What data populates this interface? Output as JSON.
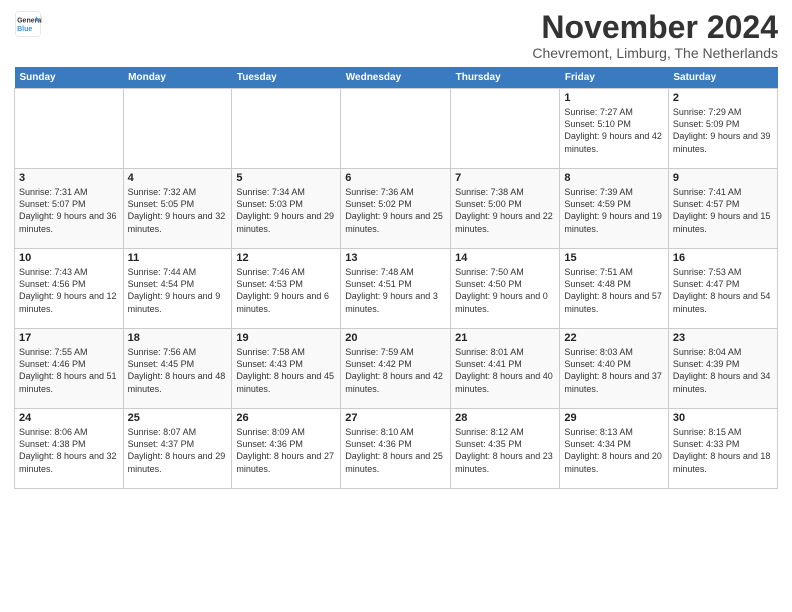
{
  "logo": {
    "general": "General",
    "blue": "Blue"
  },
  "title": "November 2024",
  "location": "Chevremont, Limburg, The Netherlands",
  "days_header": [
    "Sunday",
    "Monday",
    "Tuesday",
    "Wednesday",
    "Thursday",
    "Friday",
    "Saturday"
  ],
  "weeks": [
    [
      {
        "day": "",
        "info": ""
      },
      {
        "day": "",
        "info": ""
      },
      {
        "day": "",
        "info": ""
      },
      {
        "day": "",
        "info": ""
      },
      {
        "day": "",
        "info": ""
      },
      {
        "day": "1",
        "info": "Sunrise: 7:27 AM\nSunset: 5:10 PM\nDaylight: 9 hours and 42 minutes."
      },
      {
        "day": "2",
        "info": "Sunrise: 7:29 AM\nSunset: 5:09 PM\nDaylight: 9 hours and 39 minutes."
      }
    ],
    [
      {
        "day": "3",
        "info": "Sunrise: 7:31 AM\nSunset: 5:07 PM\nDaylight: 9 hours and 36 minutes."
      },
      {
        "day": "4",
        "info": "Sunrise: 7:32 AM\nSunset: 5:05 PM\nDaylight: 9 hours and 32 minutes."
      },
      {
        "day": "5",
        "info": "Sunrise: 7:34 AM\nSunset: 5:03 PM\nDaylight: 9 hours and 29 minutes."
      },
      {
        "day": "6",
        "info": "Sunrise: 7:36 AM\nSunset: 5:02 PM\nDaylight: 9 hours and 25 minutes."
      },
      {
        "day": "7",
        "info": "Sunrise: 7:38 AM\nSunset: 5:00 PM\nDaylight: 9 hours and 22 minutes."
      },
      {
        "day": "8",
        "info": "Sunrise: 7:39 AM\nSunset: 4:59 PM\nDaylight: 9 hours and 19 minutes."
      },
      {
        "day": "9",
        "info": "Sunrise: 7:41 AM\nSunset: 4:57 PM\nDaylight: 9 hours and 15 minutes."
      }
    ],
    [
      {
        "day": "10",
        "info": "Sunrise: 7:43 AM\nSunset: 4:56 PM\nDaylight: 9 hours and 12 minutes."
      },
      {
        "day": "11",
        "info": "Sunrise: 7:44 AM\nSunset: 4:54 PM\nDaylight: 9 hours and 9 minutes."
      },
      {
        "day": "12",
        "info": "Sunrise: 7:46 AM\nSunset: 4:53 PM\nDaylight: 9 hours and 6 minutes."
      },
      {
        "day": "13",
        "info": "Sunrise: 7:48 AM\nSunset: 4:51 PM\nDaylight: 9 hours and 3 minutes."
      },
      {
        "day": "14",
        "info": "Sunrise: 7:50 AM\nSunset: 4:50 PM\nDaylight: 9 hours and 0 minutes."
      },
      {
        "day": "15",
        "info": "Sunrise: 7:51 AM\nSunset: 4:48 PM\nDaylight: 8 hours and 57 minutes."
      },
      {
        "day": "16",
        "info": "Sunrise: 7:53 AM\nSunset: 4:47 PM\nDaylight: 8 hours and 54 minutes."
      }
    ],
    [
      {
        "day": "17",
        "info": "Sunrise: 7:55 AM\nSunset: 4:46 PM\nDaylight: 8 hours and 51 minutes."
      },
      {
        "day": "18",
        "info": "Sunrise: 7:56 AM\nSunset: 4:45 PM\nDaylight: 8 hours and 48 minutes."
      },
      {
        "day": "19",
        "info": "Sunrise: 7:58 AM\nSunset: 4:43 PM\nDaylight: 8 hours and 45 minutes."
      },
      {
        "day": "20",
        "info": "Sunrise: 7:59 AM\nSunset: 4:42 PM\nDaylight: 8 hours and 42 minutes."
      },
      {
        "day": "21",
        "info": "Sunrise: 8:01 AM\nSunset: 4:41 PM\nDaylight: 8 hours and 40 minutes."
      },
      {
        "day": "22",
        "info": "Sunrise: 8:03 AM\nSunset: 4:40 PM\nDaylight: 8 hours and 37 minutes."
      },
      {
        "day": "23",
        "info": "Sunrise: 8:04 AM\nSunset: 4:39 PM\nDaylight: 8 hours and 34 minutes."
      }
    ],
    [
      {
        "day": "24",
        "info": "Sunrise: 8:06 AM\nSunset: 4:38 PM\nDaylight: 8 hours and 32 minutes."
      },
      {
        "day": "25",
        "info": "Sunrise: 8:07 AM\nSunset: 4:37 PM\nDaylight: 8 hours and 29 minutes."
      },
      {
        "day": "26",
        "info": "Sunrise: 8:09 AM\nSunset: 4:36 PM\nDaylight: 8 hours and 27 minutes."
      },
      {
        "day": "27",
        "info": "Sunrise: 8:10 AM\nSunset: 4:36 PM\nDaylight: 8 hours and 25 minutes."
      },
      {
        "day": "28",
        "info": "Sunrise: 8:12 AM\nSunset: 4:35 PM\nDaylight: 8 hours and 23 minutes."
      },
      {
        "day": "29",
        "info": "Sunrise: 8:13 AM\nSunset: 4:34 PM\nDaylight: 8 hours and 20 minutes."
      },
      {
        "day": "30",
        "info": "Sunrise: 8:15 AM\nSunset: 4:33 PM\nDaylight: 8 hours and 18 minutes."
      }
    ]
  ]
}
